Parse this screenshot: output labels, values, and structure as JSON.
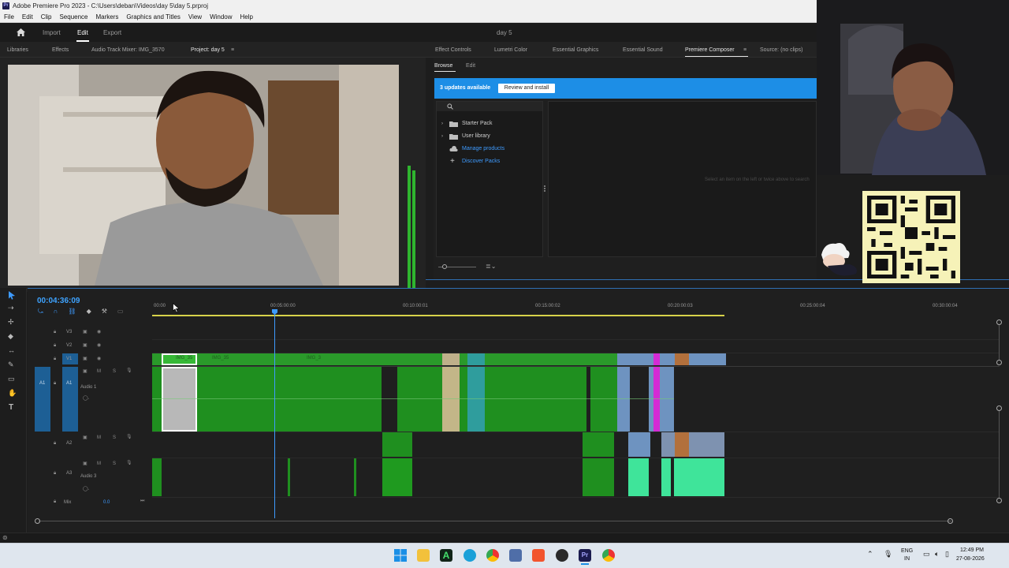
{
  "window": {
    "title": "Adobe Premiere Pro 2023 - C:\\Users\\deban\\Videos\\day 5\\day 5.prproj",
    "app_icon": "Pr"
  },
  "menu": [
    "File",
    "Edit",
    "Clip",
    "Sequence",
    "Markers",
    "Graphics and Titles",
    "View",
    "Window",
    "Help"
  ],
  "topnav": {
    "import": "Import",
    "edit": "Edit",
    "export": "Export",
    "project_name": "day 5"
  },
  "left_tabs": {
    "libraries": "Libraries",
    "effects": "Effects",
    "audio_mixer": "Audio Track Mixer: IMG_3570",
    "project": "Project: day 5"
  },
  "right_tabs": {
    "effect_controls": "Effect Controls",
    "lumetri": "Lumetri Color",
    "essential_graphics": "Essential Graphics",
    "essential_sound": "Essential Sound",
    "composer": "Premiere Composer",
    "source": "Source: (no clips)"
  },
  "composer": {
    "tab_browse": "Browse",
    "tab_edit": "Edit",
    "updates": "3 updates available",
    "review": "Review and install",
    "items": [
      {
        "label": "Starter Pack",
        "icon": "folder-icon"
      },
      {
        "label": "User library",
        "icon": "folder-icon"
      },
      {
        "label": "Manage products",
        "icon": "cloud-icon"
      },
      {
        "label": "Discover Packs",
        "icon": "plus-icon"
      }
    ],
    "hint": "Select an item on the left or twice above to search"
  },
  "timeline": {
    "timecode": "00:04:36:09",
    "ruler": [
      "00:00",
      "00:05:00:00",
      "00:10:00:01",
      "00:15:00:02",
      "00:20:00:03",
      "00:25:00:04",
      "00:30:00:04"
    ],
    "tracks": {
      "v3": "V3",
      "v2": "V2",
      "v1": "V1",
      "a1": "A1",
      "a2": "A2",
      "a3": "A3",
      "audio1": "Audio 1",
      "audio3": "Audio 3",
      "mix": "Mix",
      "mix_val": "0.0",
      "a1_src": "A1"
    },
    "mute": "M",
    "solo": "S",
    "clip_labels": [
      "IMG_35",
      "IMG_35",
      "IMG_3"
    ]
  },
  "taskbar": {
    "lang": "ENG",
    "region": "IN",
    "time": "12:49 PM",
    "date": "27-08-2026"
  },
  "colors": {
    "accent": "#1d8ee6",
    "timecode": "#3ea3ff",
    "clip_green": "#20a020",
    "clip_mint": "#3fe49a"
  }
}
